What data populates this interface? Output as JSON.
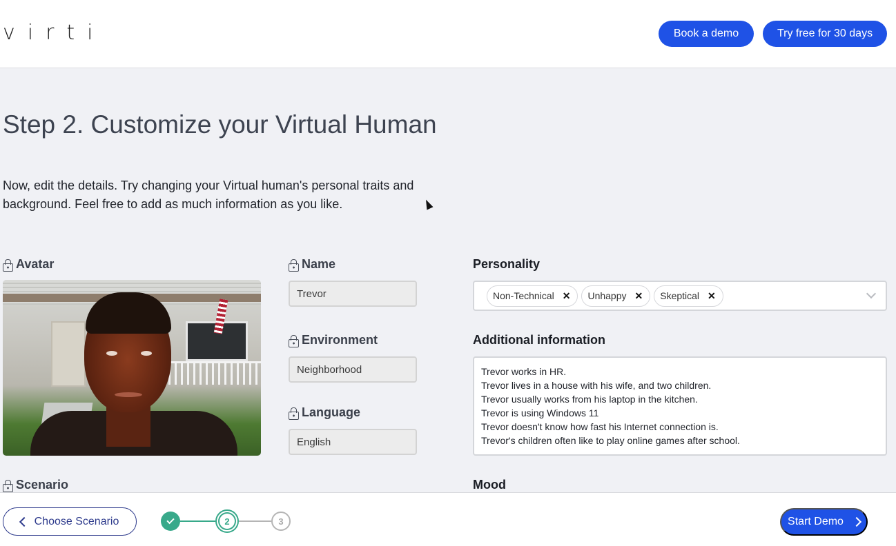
{
  "header": {
    "logo": "virti",
    "book_demo": "Book a demo",
    "try_free": "Try free for 30 days"
  },
  "page": {
    "title": "Step 2. Customize your Virtual Human",
    "intro": "Now, edit the details. Try changing your Virtual human's personal traits and background. Feel free to add as much information as you like."
  },
  "form": {
    "avatar_label": "Avatar",
    "name_label": "Name",
    "name_value": "Trevor",
    "environment_label": "Environment",
    "environment_value": "Neighborhood",
    "language_label": "Language",
    "language_value": "English",
    "scenario_label": "Scenario",
    "personality_label": "Personality",
    "personality_tags": [
      "Non-Technical",
      "Unhappy",
      "Skeptical"
    ],
    "additional_label": "Additional information",
    "additional_value": "Trevor works in HR.\nTrevor lives in a house with his wife, and two children.\nTrevor usually works from his laptop in the kitchen.\nTrevor is using Windows 11\nTrevor doesn't know how fast his Internet connection is.\nTrevor's children often like to play online games after school.",
    "mood_label": "Mood"
  },
  "footer": {
    "back_label": "Choose Scenario",
    "steps": [
      "1",
      "2",
      "3"
    ],
    "current_step": 2,
    "start_label": "Start Demo"
  },
  "colors": {
    "primary": "#1f52e6",
    "step_accent": "#38a98a",
    "back_outline": "#2d3a8c"
  }
}
